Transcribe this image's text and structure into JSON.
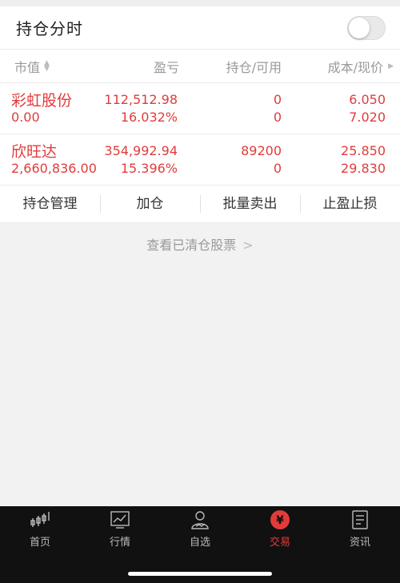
{
  "header": {
    "title": "持仓分时",
    "toggle_on": false
  },
  "columns": {
    "c1": "市值",
    "c2": "盈亏",
    "c3": "持仓/可用",
    "c4": "成本/现价"
  },
  "rows": [
    {
      "name": "彩虹股份",
      "market_value": "0.00",
      "pnl": "112,512.98",
      "pnl_pct": "16.032%",
      "holding": "0",
      "available": "0",
      "cost": "6.050",
      "price": "7.020"
    },
    {
      "name": "欣旺达",
      "market_value": "2,660,836.00",
      "pnl": "354,992.94",
      "pnl_pct": "15.396%",
      "holding": "89200",
      "available": "0",
      "cost": "25.850",
      "price": "29.830"
    }
  ],
  "actions": [
    "持仓管理",
    "加仓",
    "批量卖出",
    "止盈止损"
  ],
  "cleared_link": "查看已清仓股票",
  "tabs": [
    {
      "label": "首页",
      "icon": "candlestick-icon"
    },
    {
      "label": "行情",
      "icon": "chart-icon"
    },
    {
      "label": "自选",
      "icon": "user-icon"
    },
    {
      "label": "交易",
      "icon": "yen-icon"
    },
    {
      "label": "资讯",
      "icon": "document-icon"
    }
  ],
  "colors": {
    "accent": "#e33b3b",
    "tabbar": "#111111"
  }
}
